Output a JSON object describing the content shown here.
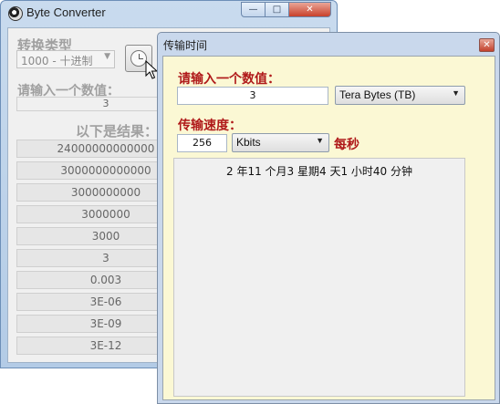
{
  "bg_window": {
    "title": "Byte Converter",
    "minimize_glyph": "—",
    "maximize_glyph": "□",
    "close_glyph": "✕",
    "type_label": "转换类型",
    "type_select": "1000 - 十进制",
    "value_label": "请输入一个数值：",
    "value": "3",
    "results_label": "以下是结果：",
    "results": [
      "24000000000000",
      "3000000000000",
      "3000000000",
      "3000000",
      "3000",
      "3",
      "0.003",
      "3E-06",
      "3E-09",
      "3E-12"
    ]
  },
  "dialog": {
    "title": "传输时间",
    "close_glyph": "✕",
    "input_label": "请输入一个数值：",
    "input_value": "3",
    "unit_select": "Tera Bytes (TB)",
    "speed_label": "传输速度：",
    "speed_value": "256",
    "rate_select": "Kbits",
    "per_second": "每秒",
    "result": "2 年11 个月3 星期4 天1 小时40 分钟"
  },
  "colors": {
    "label_red": "#b01a1a",
    "dialog_bg": "#fbf8d4",
    "bg_label_gray": "#a0a0a0"
  },
  "icons": [
    "app-icon",
    "clock-icon",
    "pointer-cursor",
    "chevron-down-icon",
    "close-icon"
  ]
}
